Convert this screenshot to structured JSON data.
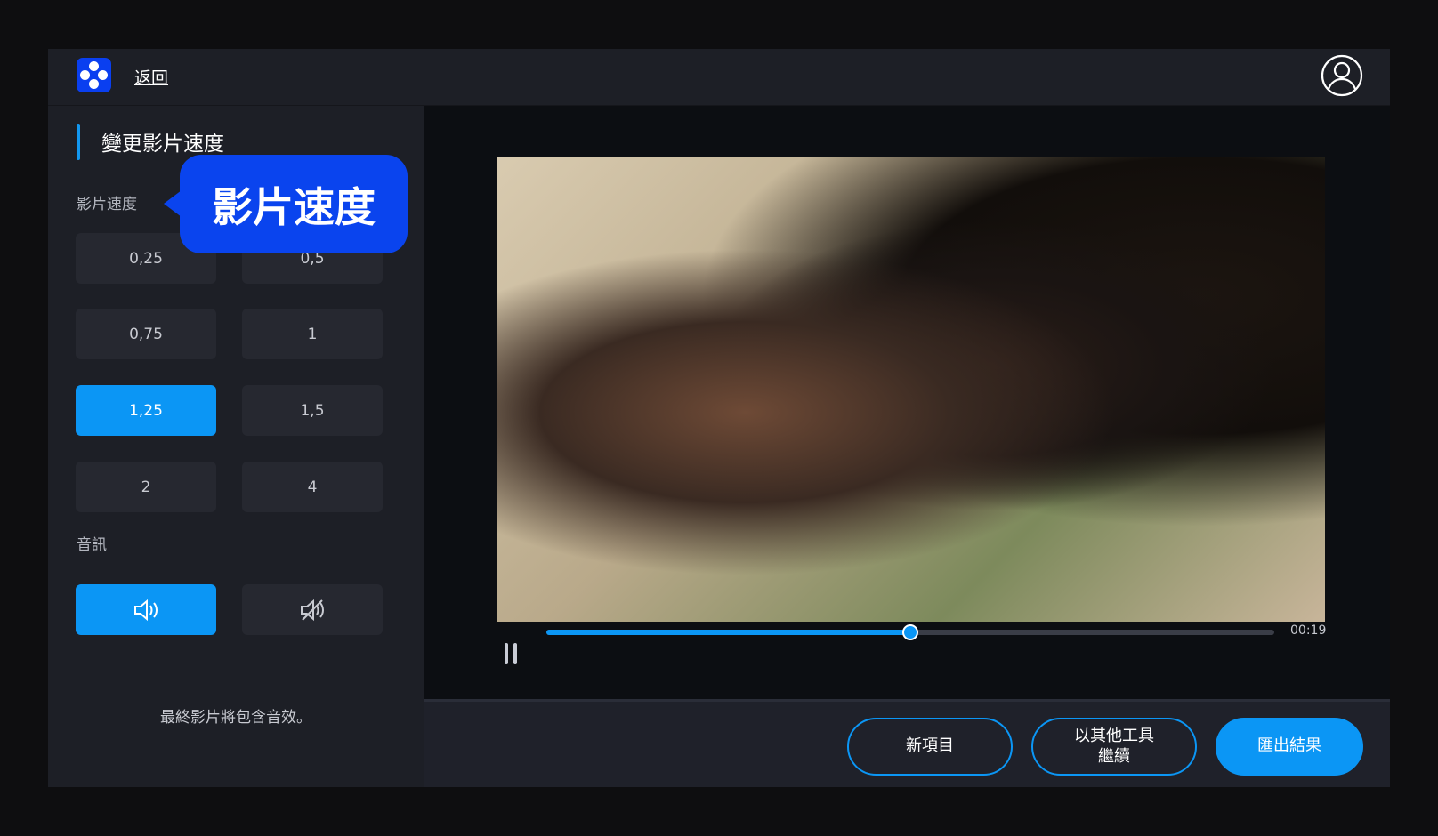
{
  "header": {
    "back_label": "返回",
    "logo_icon": "app-logo",
    "account_icon": "user-circle-icon"
  },
  "sidebar": {
    "title": "變更影片速度",
    "speed_label": "影片速度",
    "speeds": [
      "0,25",
      "0,5",
      "0,75",
      "1",
      "1,25",
      "1,5",
      "2",
      "4"
    ],
    "selected_speed": "1,25",
    "audio_label": "音訊",
    "audio_on_icon": "speaker-icon",
    "audio_off_icon": "speaker-muted-icon",
    "audio_note": "最終影片將包含音效。"
  },
  "callout": {
    "text": "影片速度"
  },
  "player": {
    "time": "00:19",
    "progress_percent": 50
  },
  "footer": {
    "new_project": "新項目",
    "continue_other": "以其他工具\n繼續",
    "export": "匯出結果"
  },
  "colors": {
    "accent": "#0b96f5",
    "callout": "#0a44ee"
  }
}
